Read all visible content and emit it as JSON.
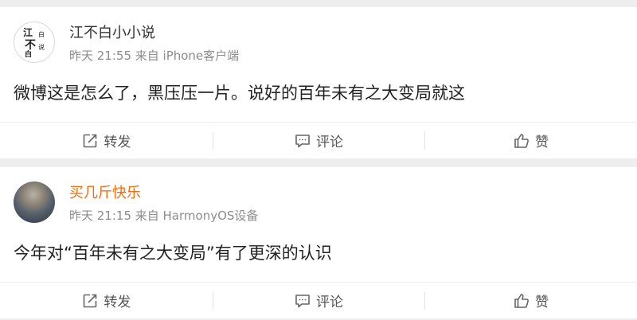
{
  "posts": [
    {
      "username": "江不白小小说",
      "meta": "昨天 21:55 来自 iPhone客户端",
      "content": "微博这是怎么了，黑压压一片。说好的百年未有之大变局就这",
      "avatar_glyphs": [
        "江",
        "白",
        "不",
        "说",
        "白"
      ],
      "actions": {
        "repost": "转发",
        "comment": "评论",
        "like": "赞"
      }
    },
    {
      "username": "买几斤快乐",
      "meta": "昨天 21:15 来自 HarmonyOS设备",
      "content": "今年对“百年未有之大变局”有了更深的认识",
      "actions": {
        "repost": "转发",
        "comment": "评论",
        "like": "赞"
      }
    }
  ],
  "colors": {
    "username_default": "#333333",
    "username_highlight": "#f86b0e",
    "meta": "#8c8c8c",
    "background": "#eeeeee"
  },
  "icons": [
    "repost-icon",
    "comment-icon",
    "like-icon"
  ]
}
